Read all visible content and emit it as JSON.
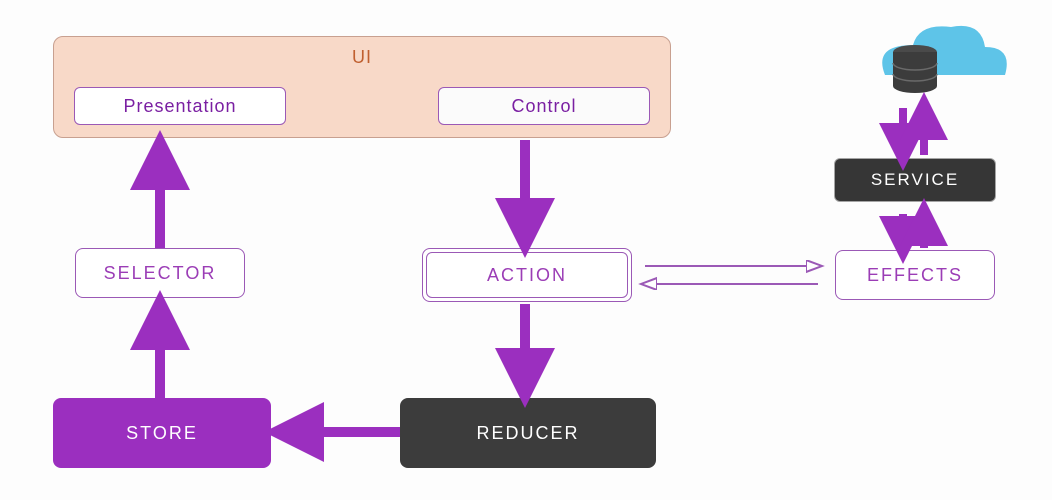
{
  "ui": {
    "title": "UI",
    "presentation": "Presentation",
    "control": "Control"
  },
  "selector": "SELECTOR",
  "action": "ACTION",
  "effects": "EFFECTS",
  "service": "SERVICE",
  "store": "STORE",
  "reducer": "REDUCER",
  "colors": {
    "purple": "#9b2fbf",
    "purpleBorder": "#9b59b6",
    "ui_bg": "#f8d9c8",
    "dark": "#3c3c3c",
    "arrow_outline": "#9b59b6",
    "cloud": "#5ec4e8"
  }
}
